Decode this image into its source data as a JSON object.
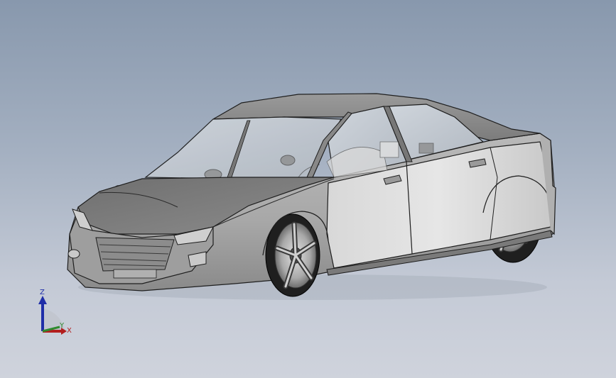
{
  "viewport": {
    "background_top": "#8898ad",
    "background_bottom": "#cfd3dc"
  },
  "model": {
    "body_color": "#a6a6a6",
    "glass_color": "#c6cdd6",
    "tire_color": "#2a2a2a",
    "rim_color": "#bcbcbc"
  },
  "triad": {
    "z_label": "Z",
    "y_label": "Y",
    "x_label": "X",
    "z_color": "#1f2ea8",
    "y_color": "#2f8a2f",
    "x_color": "#b21e1e"
  }
}
